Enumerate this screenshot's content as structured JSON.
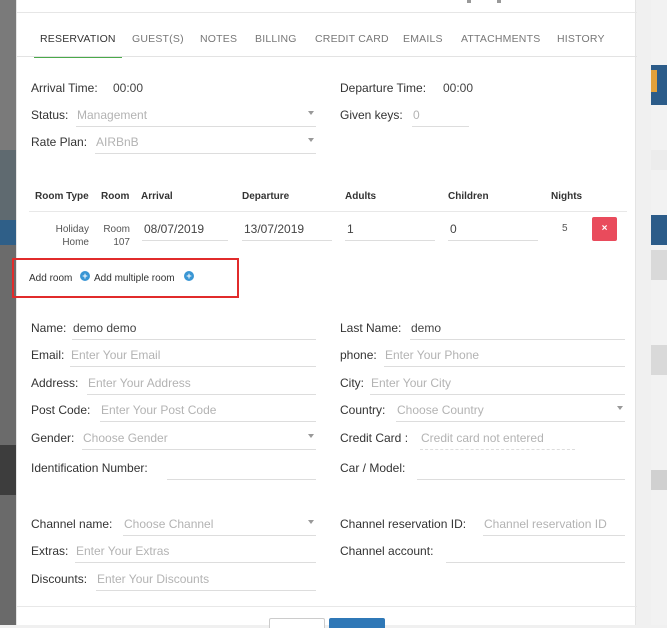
{
  "tabs": [
    {
      "label": "RESERVATION",
      "active": true
    },
    {
      "label": "GUEST(S)",
      "active": false
    },
    {
      "label": "NOTES",
      "active": false
    },
    {
      "label": "BILLING",
      "active": false
    },
    {
      "label": "CREDIT CARD",
      "active": false
    },
    {
      "label": "EMAILS",
      "active": false
    },
    {
      "label": "ATTACHMENTS",
      "active": false
    },
    {
      "label": "HISTORY",
      "active": false
    }
  ],
  "reservation": {
    "arrival_time": {
      "label": "Arrival Time:",
      "value": "00:00"
    },
    "departure_time": {
      "label": "Departure Time:",
      "value": "00:00"
    },
    "status": {
      "label": "Status:",
      "value": "Management"
    },
    "given_keys": {
      "label": "Given keys:",
      "value": "0"
    },
    "rate_plan": {
      "label": "Rate Plan:",
      "value": "AIRBnB"
    }
  },
  "rooms": {
    "headers": {
      "room_type": "Room Type",
      "room": "Room",
      "arrival": "Arrival",
      "departure": "Departure",
      "adults": "Adults",
      "children": "Children",
      "nights": "Nights"
    },
    "row": {
      "room_type_1": "Holiday",
      "room_type_2": "Home",
      "room_1": "Room",
      "room_2": "107",
      "arrival": "08/07/2019",
      "departure": "13/07/2019",
      "adults": "1",
      "children": "0",
      "nights": "5",
      "delete_icon": "×"
    },
    "add_room": "Add room",
    "add_multiple_room": "Add multiple room",
    "plus_icon": "+"
  },
  "guest": {
    "name": {
      "label": "Name:",
      "value": "demo demo"
    },
    "last_name": {
      "label": "Last Name:",
      "value": "demo"
    },
    "email": {
      "label": "Email:",
      "placeholder": "Enter Your Email"
    },
    "phone": {
      "label": "phone:",
      "placeholder": "Enter Your Phone"
    },
    "address": {
      "label": "Address:",
      "placeholder": "Enter Your Address"
    },
    "city": {
      "label": "City:",
      "placeholder": "Enter Your City"
    },
    "post_code": {
      "label": "Post Code:",
      "placeholder": "Enter Your Post Code"
    },
    "country": {
      "label": "Country:",
      "placeholder": "Choose Country"
    },
    "gender": {
      "label": "Gender:",
      "placeholder": "Choose Gender"
    },
    "credit_card": {
      "label": "Credit Card :",
      "placeholder": "Credit card not entered"
    },
    "identification_number": {
      "label": "Identification Number:",
      "value": ""
    },
    "car_model": {
      "label": "Car / Model:",
      "value": ""
    }
  },
  "channel": {
    "channel_name": {
      "label": "Channel name:",
      "placeholder": "Choose Channel"
    },
    "channel_reservation_id": {
      "label": "Channel reservation ID:",
      "placeholder": "Channel reservation ID"
    },
    "extras": {
      "label": "Extras:",
      "placeholder": "Enter Your Extras"
    },
    "channel_account": {
      "label": "Channel account:",
      "value": ""
    },
    "discounts": {
      "label": "Discounts:",
      "placeholder": "Enter Your Discounts"
    }
  },
  "colors": {
    "active_tab_underline": "#4aa94a",
    "delete_button": "#e94b5c",
    "add_icon": "#3a96d4",
    "highlight_box": "#e12b2b",
    "primary_button": "#2f78b7"
  }
}
